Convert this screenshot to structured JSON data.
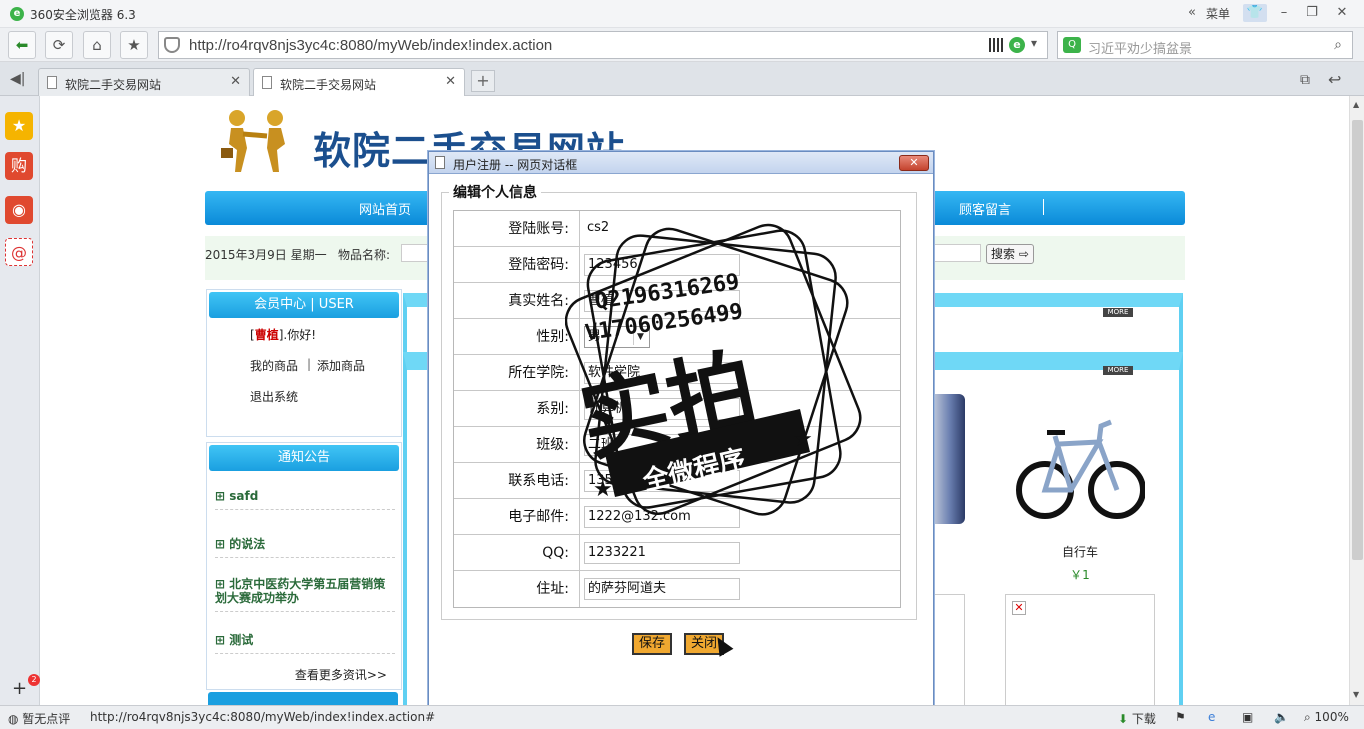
{
  "browser": {
    "title": "360安全浏览器 6.3",
    "menu_label": "菜单",
    "url": "http://ro4rqv8njs3yc4c:8080/myWeb/index!index.action",
    "search_placeholder": "习近平劝少搞盆景",
    "tabs": [
      {
        "label": "软院二手交易网站",
        "active": false
      },
      {
        "label": "软院二手交易网站",
        "active": true
      }
    ],
    "status": {
      "rating": "暂无点评",
      "link": "http://ro4rqv8njs3yc4c:8080/myWeb/index!index.action#",
      "download": "下载",
      "zoom": "100%",
      "badge": "2"
    }
  },
  "site": {
    "title": "软院二手交易网站",
    "nav": [
      "网站首页",
      "顾客留言"
    ],
    "date": "2015年3月9日  星期一",
    "item_label": "物品名称:",
    "search_button": "搜索",
    "member_panel": {
      "title": "会员中心  | USER",
      "user": "曹植",
      "greeting": "].你好!",
      "my_items": "我的商品",
      "add_item": "添加商品",
      "logout": "退出系统"
    },
    "notice_panel": {
      "title": "通知公告",
      "items": [
        "safd",
        "的说法",
        "北京中医药大学第五届营销策划大赛成功举办",
        "测试"
      ],
      "more": "查看更多资讯>>"
    },
    "more_badge": "MORE",
    "product": {
      "name": "自行车",
      "price": "￥1"
    }
  },
  "dialog": {
    "title": "用户注册 -- 网页对话框",
    "legend": "编辑个人信息",
    "fields": [
      {
        "label": "登陆账号:",
        "value": "cs2"
      },
      {
        "label": "登陆密码:",
        "value": "123456"
      },
      {
        "label": "真实姓名:",
        "value": "曹植"
      },
      {
        "label": "性别:",
        "value": "男"
      },
      {
        "label": "所在学院:",
        "value": "软件学院"
      },
      {
        "label": "系别:",
        "value": "计算机"
      },
      {
        "label": "班级:",
        "value": "二班"
      },
      {
        "label": "联系电话:",
        "value": "1354343"
      },
      {
        "label": "电子邮件:",
        "value": "1222@132.com"
      },
      {
        "label": "QQ:",
        "value": "1233221"
      },
      {
        "label": "住址:",
        "value": "的萨芬阿道夫"
      }
    ],
    "save": "保存",
    "close": "关闭"
  },
  "watermark": {
    "qq": "Q2196316269",
    "v": "V17060256499",
    "main": "实拍",
    "ribbon": "全微程序"
  }
}
